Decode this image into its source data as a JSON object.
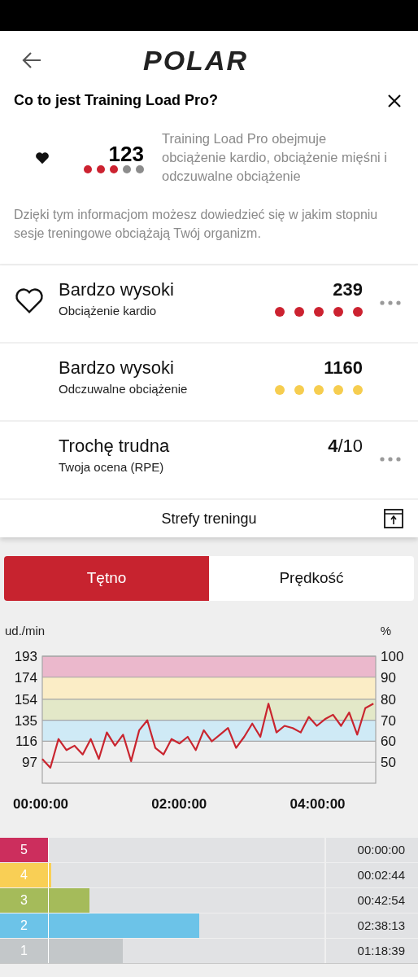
{
  "header": {
    "logo": "POLAR"
  },
  "info": {
    "title": "Co to jest Training Load Pro?",
    "score": "123",
    "stars": 3,
    "description": "Training Load Pro obejmuje obciążenie kardio, obciążenie mięśni i odczuwalne obciążenie",
    "note": "Dzięki tym informacjom możesz dowiedzieć się w jakim stopniu sesje treningowe obciążają Twój organizm."
  },
  "loads": [
    {
      "kind": "cardio",
      "title": "Bardzo wysoki",
      "subtitle": "Obciążenie kardio",
      "value": "239",
      "stars": 5,
      "color": "#cc2230",
      "more": true
    },
    {
      "kind": "perceived",
      "title": "Bardzo wysoki",
      "subtitle": "Odczuwalne obciążenie",
      "value": "1160",
      "stars": 5,
      "color": "#f6cd4f",
      "more": false
    },
    {
      "kind": "rpe",
      "title": "Trochę trudna",
      "subtitle": "Twoja ocena (RPE)",
      "value": "**4**/10",
      "more": true
    }
  ],
  "zones_link": {
    "label": "Strefy treningu"
  },
  "tabs": [
    {
      "label": "Tętno",
      "selected": true
    },
    {
      "label": "Prędkość",
      "selected": false
    }
  ],
  "chart": {
    "unit_left": "ud./min",
    "unit_right": "%",
    "right_ticks": [
      "100",
      "90",
      "80",
      "70",
      "60",
      "50"
    ],
    "chart_data": {
      "type": "line",
      "xlim": [
        0,
        289
      ],
      "ylim": [
        78,
        193
      ],
      "xticks": [
        {
          "value": 0,
          "label": "00:00:00"
        },
        {
          "value": 120,
          "label": "02:00:00"
        },
        {
          "value": 240,
          "label": "04:00:00"
        }
      ],
      "yticks": [
        193,
        174,
        154,
        135,
        116,
        97
      ],
      "grid": true,
      "x": [
        0,
        7,
        14,
        21,
        28,
        35,
        42,
        49,
        56,
        63,
        70,
        77,
        84,
        91,
        98,
        105,
        112,
        119,
        126,
        133,
        140,
        147,
        154,
        161,
        168,
        175,
        182,
        189,
        196,
        203,
        210,
        217,
        224,
        231,
        238,
        245,
        252,
        259,
        266,
        273,
        280,
        287
      ],
      "series": [
        {
          "color": "#c9252f",
          "values": [
            100,
            92,
            118,
            108,
            112,
            104,
            118,
            100,
            124,
            112,
            122,
            98,
            126,
            135,
            110,
            104,
            118,
            114,
            120,
            108,
            126,
            116,
            122,
            128,
            110,
            120,
            132,
            120,
            150,
            124,
            130,
            128,
            124,
            138,
            130,
            136,
            140,
            130,
            142,
            122,
            146,
            150
          ]
        }
      ]
    }
  },
  "zones": [
    {
      "label": "5",
      "time": "00:00:00",
      "color": "#cc2e5d",
      "level": 0.148
    },
    {
      "label": "4",
      "time": "00:02:44",
      "color": "#f9cf55",
      "level": 0.158
    },
    {
      "label": "3",
      "time": "00:42:54",
      "color": "#a5bb5a",
      "level": 0.275
    },
    {
      "label": "2",
      "time": "02:38:13",
      "color": "#6cc3e8",
      "level": 0.615
    },
    {
      "label": "1",
      "time": "01:18:39",
      "color": "#c3c7c9",
      "level": 0.378
    }
  ]
}
